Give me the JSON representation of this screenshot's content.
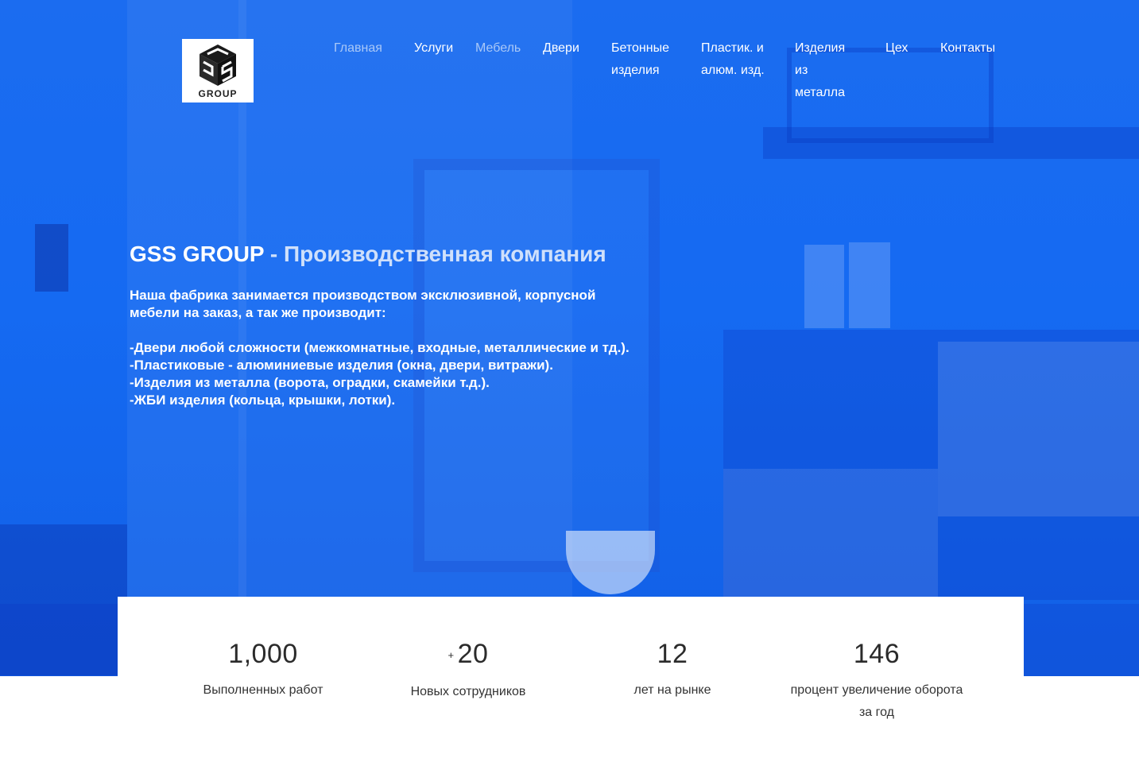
{
  "brand": {
    "logo_text": "GROUP"
  },
  "nav": {
    "items": [
      {
        "label": "Главная",
        "state": "muted"
      },
      {
        "label": "Услуги",
        "state": "normal"
      },
      {
        "label": "Мебель",
        "state": "muted"
      },
      {
        "label": "Двери",
        "state": "normal"
      },
      {
        "label": "Бетонные\nизделия",
        "state": "normal"
      },
      {
        "label": "Пластик. и\nалюм. изд.",
        "state": "normal"
      },
      {
        "label": "Изделия\nиз\nметалла",
        "state": "normal"
      },
      {
        "label": "Цех",
        "state": "normal"
      },
      {
        "label": "Контакты",
        "state": "normal"
      }
    ]
  },
  "hero": {
    "brand_title": "GSS GROUP",
    "separator": " - ",
    "subtitle": "Производственная компания",
    "intro": "Наша фабрика занимается производством эксклюзивной, корпусной мебели на заказ, а так же производит:",
    "list": [
      "-Двери любой сложности (межкомнатные, входные, металлические и тд.).",
      "-Пластиковые - алюминиевые изделия (окна, двери, витражи).",
      "-Изделия из металла (ворота, оградки, скамейки т.д.).",
      "-ЖБИ изделия (кольца, крышки, лотки)."
    ]
  },
  "stats": [
    {
      "prefix": "",
      "value": "1,000",
      "label": "Выполненных работ"
    },
    {
      "prefix": "+",
      "value": "20",
      "label": "Новых сотрудников"
    },
    {
      "prefix": "",
      "value": "12",
      "label": "лет на рынке"
    },
    {
      "prefix": "",
      "value": "146",
      "label": "процент увеличение оборота за год"
    }
  ],
  "colors": {
    "hero_blue": "#1b6cf0",
    "nav_muted": "#a9c8f7",
    "stats_bg": "#ffffff"
  }
}
